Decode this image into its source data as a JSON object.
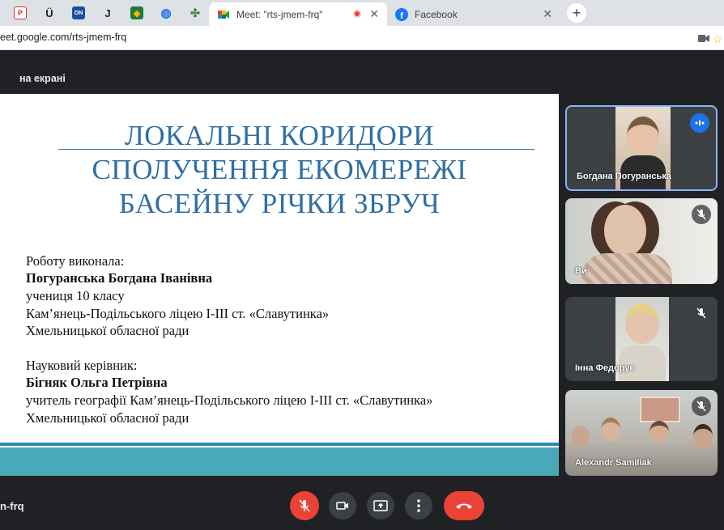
{
  "browser": {
    "pinned_tabs": [
      {
        "icon": "pdf-icon",
        "glyph": "P",
        "color": "#d93025"
      },
      {
        "icon": "u-icon",
        "glyph": "Ü",
        "color": "#202124"
      },
      {
        "icon": "on-icon",
        "glyph": "ON",
        "color": "#1a4fa0"
      },
      {
        "icon": "j-icon",
        "glyph": "J",
        "color": "#202124"
      },
      {
        "icon": "flag-icon",
        "glyph": "◆",
        "color": "#f2b600"
      },
      {
        "icon": "globe-icon",
        "glyph": "◍",
        "color": "#1a73e8"
      },
      {
        "icon": "map-icon",
        "glyph": "✣",
        "color": "#3c7a4a"
      }
    ],
    "tabs": [
      {
        "title": "Meet: \"rts-jmem-frq\"",
        "active": true
      },
      {
        "title": "Facebook",
        "active": false
      }
    ],
    "url": "eet.google.com/rts-jmem-frq"
  },
  "meet": {
    "presenting_label": "на екрані",
    "meeting_code": "n-frq"
  },
  "slide": {
    "title_lines": [
      "ЛОКАЛЬНІ КОРИДОРИ",
      "СПОЛУЧЕННЯ ЕКОМЕРЕЖІ",
      "БАСЕЙНУ РІЧКИ ЗБРУЧ"
    ],
    "author_label": "Роботу виконала:",
    "author_name": "Погуранська Богдана Іванівна",
    "author_line1": "учениця 10 класу",
    "author_line2": "Кам’янець-Подільського ліцею І-ІІІ ст. «Славутинка»",
    "author_line3": "Хмельницької обласної ради",
    "advisor_label": "Науковий керівник:",
    "advisor_name": "Бігняк Ольга Петрівна",
    "advisor_line1": "учитель географії Кам’янець-Подільського ліцею І-ІІІ ст. «Славутинка»",
    "advisor_line2": "Хмельницької обласної ради"
  },
  "participants": [
    {
      "name": "Богдана Погуранська",
      "speaking": true
    },
    {
      "name": "Ви",
      "speaking": false
    },
    {
      "name": "Інна Федорук",
      "speaking": false
    },
    {
      "name": "Alexandr Samiliak",
      "speaking": false
    }
  ],
  "colors": {
    "slide_title": "#2f6fa5",
    "slide_band": "#4aa9b8",
    "end_call": "#ea4335",
    "speaking": "#1a73e8"
  }
}
